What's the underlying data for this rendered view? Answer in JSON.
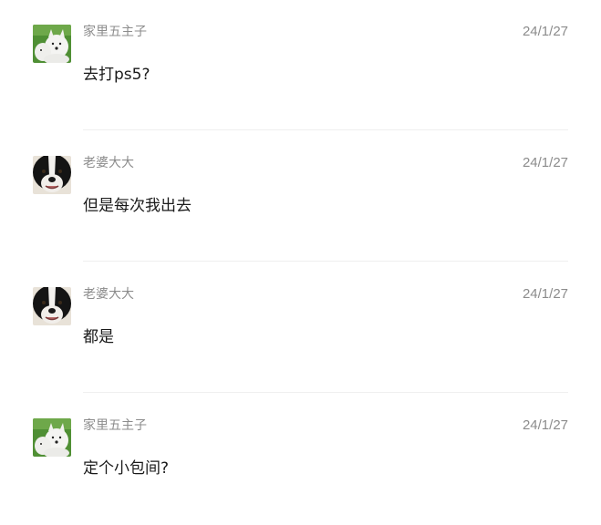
{
  "messages": [
    {
      "sender": "家里五主子",
      "time": "24/1/27",
      "text": "去打ps5?",
      "avatar": "samoyed-dog-avatar"
    },
    {
      "sender": "老婆大大",
      "time": "24/1/27",
      "text": "但是每次我出去",
      "avatar": "border-collie-avatar"
    },
    {
      "sender": "老婆大大",
      "time": "24/1/27",
      "text": "都是",
      "avatar": "border-collie-avatar"
    },
    {
      "sender": "家里五主子",
      "time": "24/1/27",
      "text": "定个小包间?",
      "avatar": "samoyed-dog-avatar"
    }
  ],
  "colors": {
    "meta_text": "#8c8c8c",
    "message_text": "#1a1a1a",
    "divider": "#efefef"
  }
}
